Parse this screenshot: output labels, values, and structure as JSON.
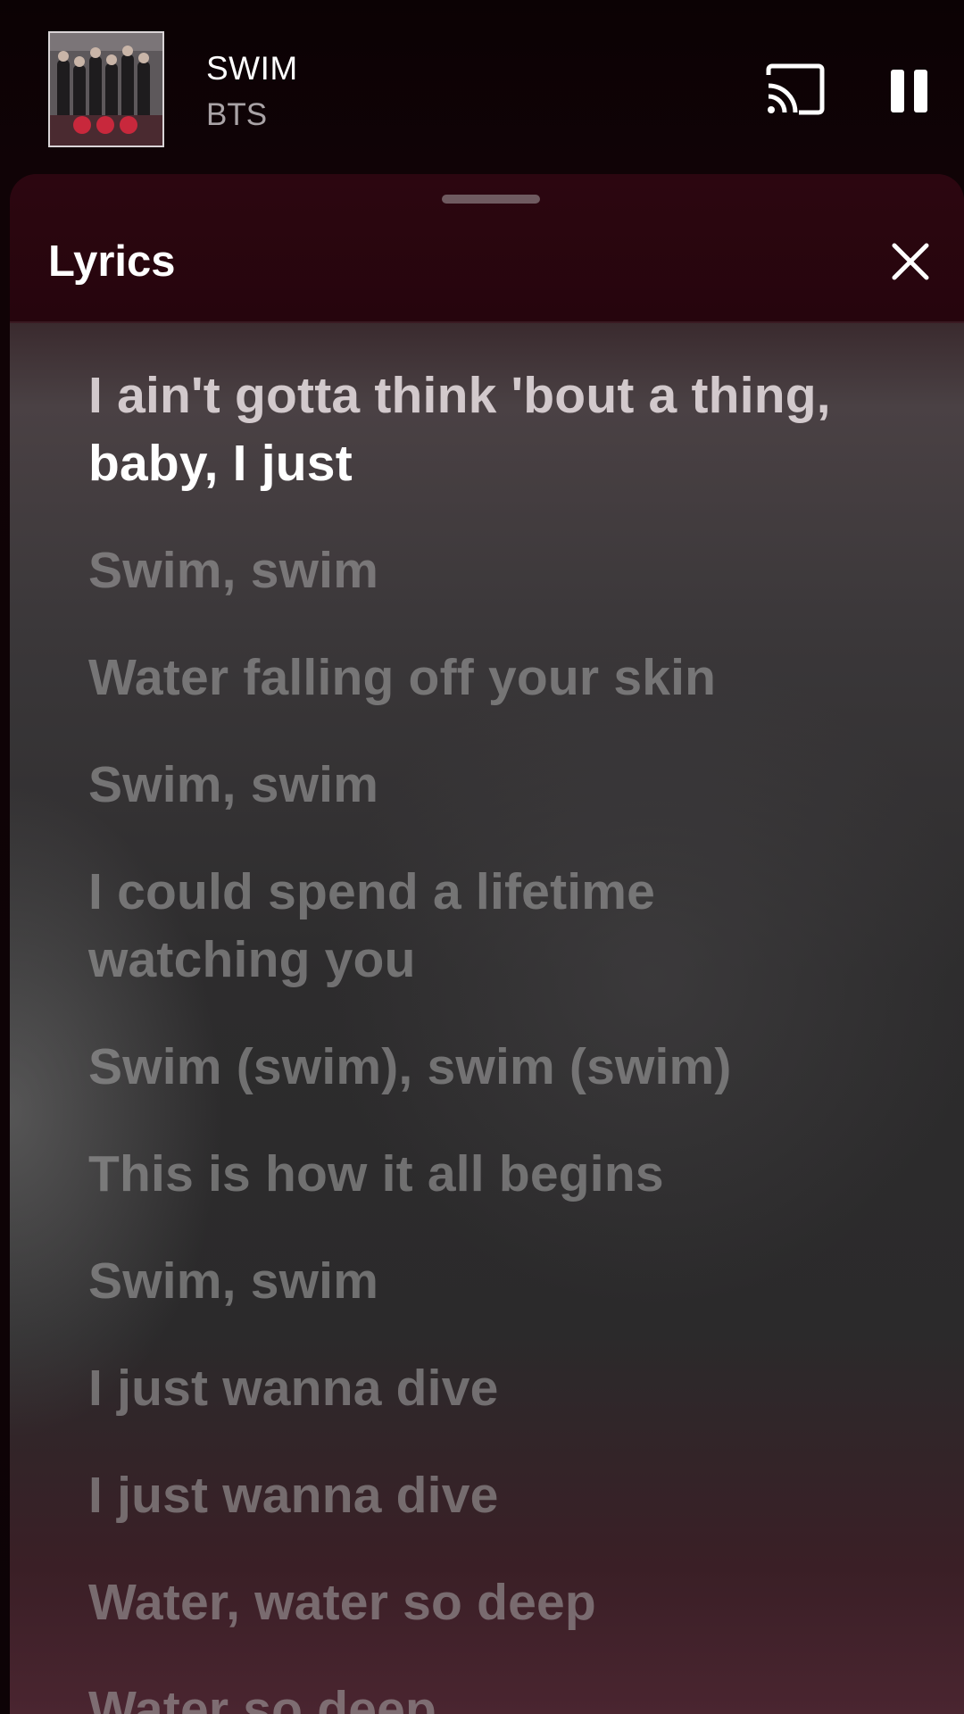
{
  "player": {
    "title": "SWIM",
    "artist": "BTS",
    "album_art": "album-cover-art",
    "cast_icon": "cast-icon",
    "pause_icon": "pause-icon"
  },
  "lyrics_sheet": {
    "title": "Lyrics",
    "close_icon": "close-icon",
    "current_line": {
      "sung": "I ain't gotta think 'bout a thing,",
      "upcoming": "baby, I just"
    },
    "lines": [
      "Swim, swim",
      "Water falling off your skin",
      "Swim, swim",
      "I could spend a lifetime watching you",
      "Swim (swim), swim (swim)",
      "This is how it all begins",
      "Swim, swim",
      "I just wanna dive",
      "I just wanna dive",
      "Water, water so deep",
      "Water so deep"
    ]
  },
  "colors": {
    "header_bg": "#0b0204",
    "sheet_header_bg": "#2a050f",
    "lyric_inactive": "#8a8a8a",
    "lyric_active": "#ffffff"
  }
}
